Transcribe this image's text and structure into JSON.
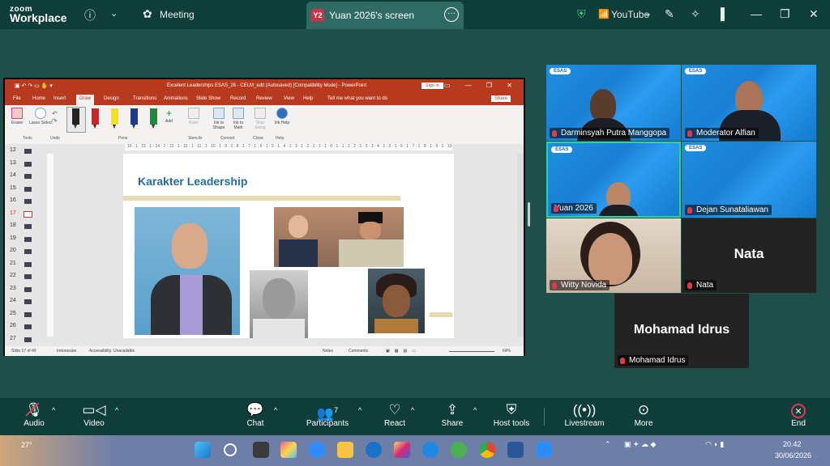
{
  "topbar": {
    "brand_small": "zoom",
    "brand_big": "Workplace",
    "meeting_label": "Meeting",
    "share_badge": "Y2",
    "share_tab_label": "Yuan 2026's screen",
    "youtube_label": "YouTube"
  },
  "ppt": {
    "title": "Excelent Leaderships ESAS_26 - CELM_edit (Autosaved) [Compatibility Mode] - PowerPoint",
    "signin": "Sign in",
    "tabs": [
      "File",
      "Home",
      "Insert",
      "Draw",
      "Design",
      "Transitions",
      "Animations",
      "Slide Show",
      "Record",
      "Review",
      "View",
      "Help"
    ],
    "active_tab": "Draw",
    "tell_me": "Tell me what you want to do",
    "share": "Share",
    "ribbon_tools": [
      "Eraser",
      "Lasso Select"
    ],
    "ribbon_groups": [
      "Tools",
      "Undo",
      "Pens",
      "Stencils",
      "Convert",
      "Close",
      "Help"
    ],
    "ribbon_buttons": [
      "Add",
      "Ruler",
      "Ink to Shape",
      "Ink to Math",
      "Stop Inking",
      "Ink Help"
    ],
    "ruler_text": "· 16 · 1 · 15 · 1 · 14 · 1 · 13 · 1 · 12 · 1 · 11 · 1 · 10 · 1 · 9 · 1 · 8 · 1 · 7 · 1 · 6 · 1 · 5 · 1 · 4 · 1 · 3 · 1 · 2 · 1 · 1 · 1 · 0 · 1 · 1 · 1 · 2 · 1 · 3 · 1 · 4 · 1 · 5 · 1 · 6 · 1 · 7 · 1 · 8 · 1 · 9 · 1 · 10 · 1 · 11 · 1 · 12 · 1 · 13 · 1 · 14 · 1 · 15 · 1 · 16 ·",
    "slide_numbers": [
      "12",
      "13",
      "14",
      "15",
      "16",
      "17",
      "18",
      "19",
      "20",
      "21",
      "22",
      "23",
      "24",
      "25",
      "26",
      "27"
    ],
    "slide_title": "Karakter Leadership",
    "status_slide": "Slide 17 of 49",
    "status_lang": "Indonesian",
    "status_access": "Accessibility: Unavailable",
    "status_notes": "Notes",
    "status_comments": "Comments",
    "zoom": "64%"
  },
  "gallery": [
    {
      "name": "Darminsyah Putra Manggopa",
      "logo": "ESAS"
    },
    {
      "name": "Moderator Alfian",
      "logo": "ESAS"
    },
    {
      "name": "Yuan 2026",
      "logo": "ESAS"
    },
    {
      "name": "Dejan Sunataliawan",
      "logo": "ESAS"
    },
    {
      "name": "Witty Novida"
    },
    {
      "name": "Nata",
      "big": "Nata"
    },
    {
      "name": "Mohamad Idrus",
      "big": "Mohamad Idrus"
    }
  ],
  "controls": {
    "audio": "Audio",
    "video": "Video",
    "chat": "Chat",
    "participants": "Participants",
    "participants_count": "7",
    "react": "React",
    "share": "Share",
    "host_tools": "Host tools",
    "livestream": "Livestream",
    "more": "More",
    "end": "End"
  },
  "taskbar": {
    "weather": "27°",
    "time": "20.42",
    "date": "30/06/2026"
  }
}
